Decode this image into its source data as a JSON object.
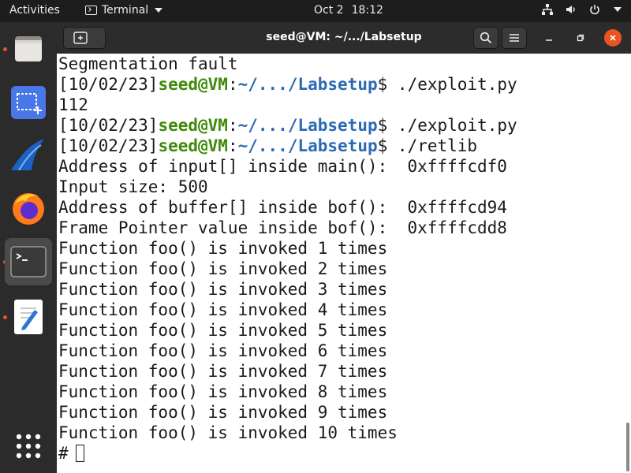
{
  "topbar": {
    "activities": "Activities",
    "app_name": "Terminal",
    "date": "Oct 2",
    "time": "18:12"
  },
  "dock": {
    "items": [
      {
        "name": "Files",
        "icon": "folder-icon",
        "running": true
      },
      {
        "name": "Screenshot",
        "icon": "screenshot-icon",
        "running": false
      },
      {
        "name": "Wireshark",
        "icon": "wireshark-icon",
        "running": false
      },
      {
        "name": "Firefox",
        "icon": "firefox-icon",
        "running": false
      },
      {
        "name": "Terminal",
        "icon": "terminal-icon",
        "running": true,
        "active": true
      },
      {
        "name": "Text Editor",
        "icon": "text-editor-icon",
        "running": true
      },
      {
        "name": "Show Applications",
        "icon": "app-grid-icon",
        "running": false
      }
    ]
  },
  "window": {
    "title": "seed@VM: ~/.../Labsetup"
  },
  "terminal": {
    "prompt": {
      "date": "[10/02/23]",
      "user": "seed@VM",
      "colon": ":",
      "path": "~/.../Labsetup",
      "dollar": "$ "
    },
    "lines": [
      {
        "kind": "text",
        "text": "Segmentation fault"
      },
      {
        "kind": "prompt",
        "cmd": "./exploit.py"
      },
      {
        "kind": "text",
        "text": "112"
      },
      {
        "kind": "prompt",
        "cmd": "./exploit.py"
      },
      {
        "kind": "prompt",
        "cmd": "./retlib"
      },
      {
        "kind": "text",
        "text": "Address of input[] inside main():  0xffffcdf0"
      },
      {
        "kind": "text",
        "text": "Input size: 500"
      },
      {
        "kind": "text",
        "text": "Address of buffer[] inside bof():  0xffffcd94"
      },
      {
        "kind": "text",
        "text": "Frame Pointer value inside bof():  0xffffcdd8"
      },
      {
        "kind": "text",
        "text": "Function foo() is invoked 1 times"
      },
      {
        "kind": "text",
        "text": "Function foo() is invoked 2 times"
      },
      {
        "kind": "text",
        "text": "Function foo() is invoked 3 times"
      },
      {
        "kind": "text",
        "text": "Function foo() is invoked 4 times"
      },
      {
        "kind": "text",
        "text": "Function foo() is invoked 5 times"
      },
      {
        "kind": "text",
        "text": "Function foo() is invoked 6 times"
      },
      {
        "kind": "text",
        "text": "Function foo() is invoked 7 times"
      },
      {
        "kind": "text",
        "text": "Function foo() is invoked 8 times"
      },
      {
        "kind": "text",
        "text": "Function foo() is invoked 9 times"
      },
      {
        "kind": "text",
        "text": "Function foo() is invoked 10 times"
      }
    ],
    "root_prompt": "#"
  },
  "colors": {
    "prompt_user": "#3f8a09",
    "prompt_path": "#2a6bb3",
    "accent": "#e95420"
  }
}
